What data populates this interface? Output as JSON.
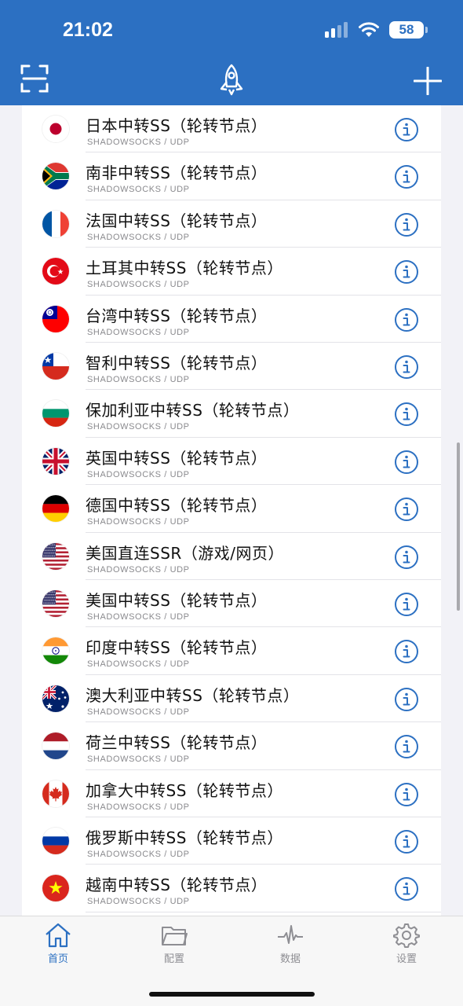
{
  "status_bar": {
    "time": "21:02",
    "battery": "58"
  },
  "nav": {
    "left_icon": "scan-icon",
    "center_icon": "rocket-icon",
    "right_icon": "plus-icon"
  },
  "servers": [
    {
      "name": "日本中转SS（轮转节点）",
      "protocol": "SHADOWSOCKS / UDP",
      "flag": "jp"
    },
    {
      "name": "南非中转SS（轮转节点）",
      "protocol": "SHADOWSOCKS / UDP",
      "flag": "za"
    },
    {
      "name": "法国中转SS（轮转节点）",
      "protocol": "SHADOWSOCKS / UDP",
      "flag": "fr"
    },
    {
      "name": "土耳其中转SS（轮转节点）",
      "protocol": "SHADOWSOCKS / UDP",
      "flag": "tr"
    },
    {
      "name": "台湾中转SS（轮转节点）",
      "protocol": "SHADOWSOCKS / UDP",
      "flag": "tw"
    },
    {
      "name": "智利中转SS（轮转节点）",
      "protocol": "SHADOWSOCKS / UDP",
      "flag": "cl"
    },
    {
      "name": "保加利亚中转SS（轮转节点）",
      "protocol": "SHADOWSOCKS / UDP",
      "flag": "bg"
    },
    {
      "name": "英国中转SS（轮转节点）",
      "protocol": "SHADOWSOCKS / UDP",
      "flag": "gb"
    },
    {
      "name": "德国中转SS（轮转节点）",
      "protocol": "SHADOWSOCKS / UDP",
      "flag": "de"
    },
    {
      "name": "美国直连SSR（游戏/网页）",
      "protocol": "SHADOWSOCKS / UDP",
      "flag": "us"
    },
    {
      "name": "美国中转SS（轮转节点）",
      "protocol": "SHADOWSOCKS / UDP",
      "flag": "us"
    },
    {
      "name": "印度中转SS（轮转节点）",
      "protocol": "SHADOWSOCKS / UDP",
      "flag": "in"
    },
    {
      "name": "澳大利亚中转SS（轮转节点）",
      "protocol": "SHADOWSOCKS / UDP",
      "flag": "au"
    },
    {
      "name": "荷兰中转SS（轮转节点）",
      "protocol": "SHADOWSOCKS / UDP",
      "flag": "nl"
    },
    {
      "name": "加拿大中转SS（轮转节点）",
      "protocol": "SHADOWSOCKS / UDP",
      "flag": "ca"
    },
    {
      "name": "俄罗斯中转SS（轮转节点）",
      "protocol": "SHADOWSOCKS / UDP",
      "flag": "ru"
    },
    {
      "name": "越南中转SS（轮转节点）",
      "protocol": "SHADOWSOCKS / UDP",
      "flag": "vn"
    }
  ],
  "tabs": [
    {
      "label": "首页",
      "icon": "home-icon",
      "active": true
    },
    {
      "label": "配置",
      "icon": "folder-icon",
      "active": false
    },
    {
      "label": "数据",
      "icon": "activity-icon",
      "active": false
    },
    {
      "label": "设置",
      "icon": "gear-icon",
      "active": false
    }
  ],
  "colors": {
    "accent": "#2c70c2",
    "info_icon": "#2c70c2"
  }
}
